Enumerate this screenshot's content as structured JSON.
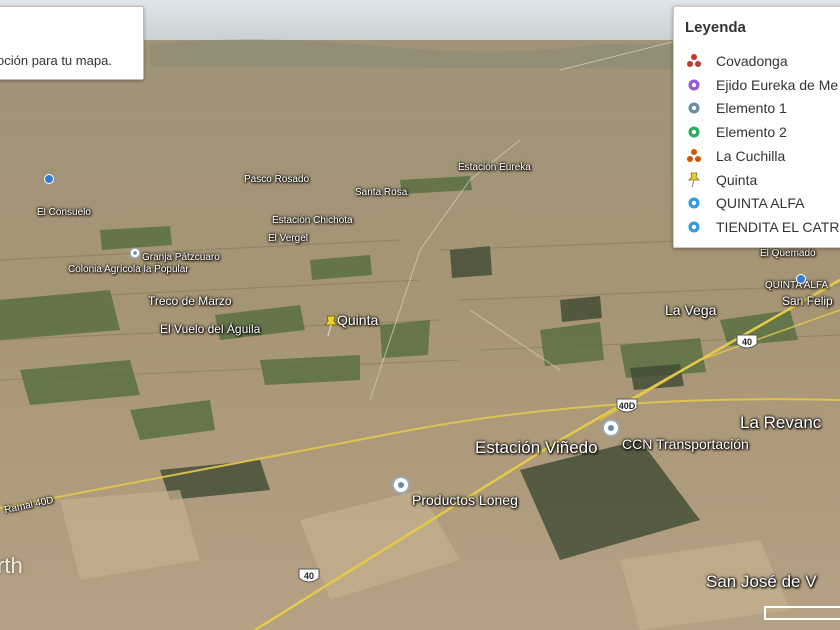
{
  "info_box": {
    "text": "oción para tu mapa."
  },
  "legend": {
    "title": "Leyenda",
    "items": [
      {
        "label": "Covadonga",
        "icon": "triad-red-icon",
        "color": "#c0392b"
      },
      {
        "label": "Ejido Eureka de Me",
        "icon": "purple-pin-icon",
        "color": "#9b59d0"
      },
      {
        "label": "Elemento 1",
        "icon": "gray-blue-pin-icon",
        "color": "#6a8ca8"
      },
      {
        "label": "Elemento 2",
        "icon": "green-pin-icon",
        "color": "#27ae60"
      },
      {
        "label": "La Cuchilla",
        "icon": "triad-orange-icon",
        "color": "#d35400"
      },
      {
        "label": "Quinta",
        "icon": "yellow-pushpin-icon",
        "color": "#f1d02a"
      },
      {
        "label": "QUINTA ALFA",
        "icon": "blue-pin-icon",
        "color": "#3498db"
      },
      {
        "label": "TIENDITA EL CATR",
        "icon": "blue-pin-icon",
        "color": "#3498db"
      }
    ]
  },
  "map": {
    "labels": {
      "quinta": "Quinta",
      "el_vuelo": "El Vuelo del Águila",
      "trece_marzo": "Treco de Marzo",
      "colonia": "Colonia Agrícola la Popular",
      "granja": "Granja Pátzcuaro",
      "el_vergel": "El Vergel",
      "estacion_chichota": "Estación Chichota",
      "el_consuelo": "El Consuelo",
      "pasco": "Pasco Rosado",
      "santa_rosa": "Santa Rosa",
      "estacion_top": "Estación Eureka",
      "estacion_vinedo": "Estación Viñedo",
      "ccn": "CCN Transportación",
      "productos": "Productos Loneg",
      "la_vega": "La Vega",
      "la_revancha": "La Revanc",
      "el_quemado": "El Quemado",
      "quinta_alfa": "QUINTA ALFA",
      "san_felipe": "San Felip",
      "san_jose": "San José de V",
      "road_left": "Ramal 40D",
      "hw_40d": "40D",
      "hw_40_a": "40",
      "hw_40_b": "40"
    },
    "watermark": "rth",
    "colors": {
      "road": "#e6c84a",
      "field_green": "#4f6b3c",
      "soil": "#a99877"
    }
  }
}
